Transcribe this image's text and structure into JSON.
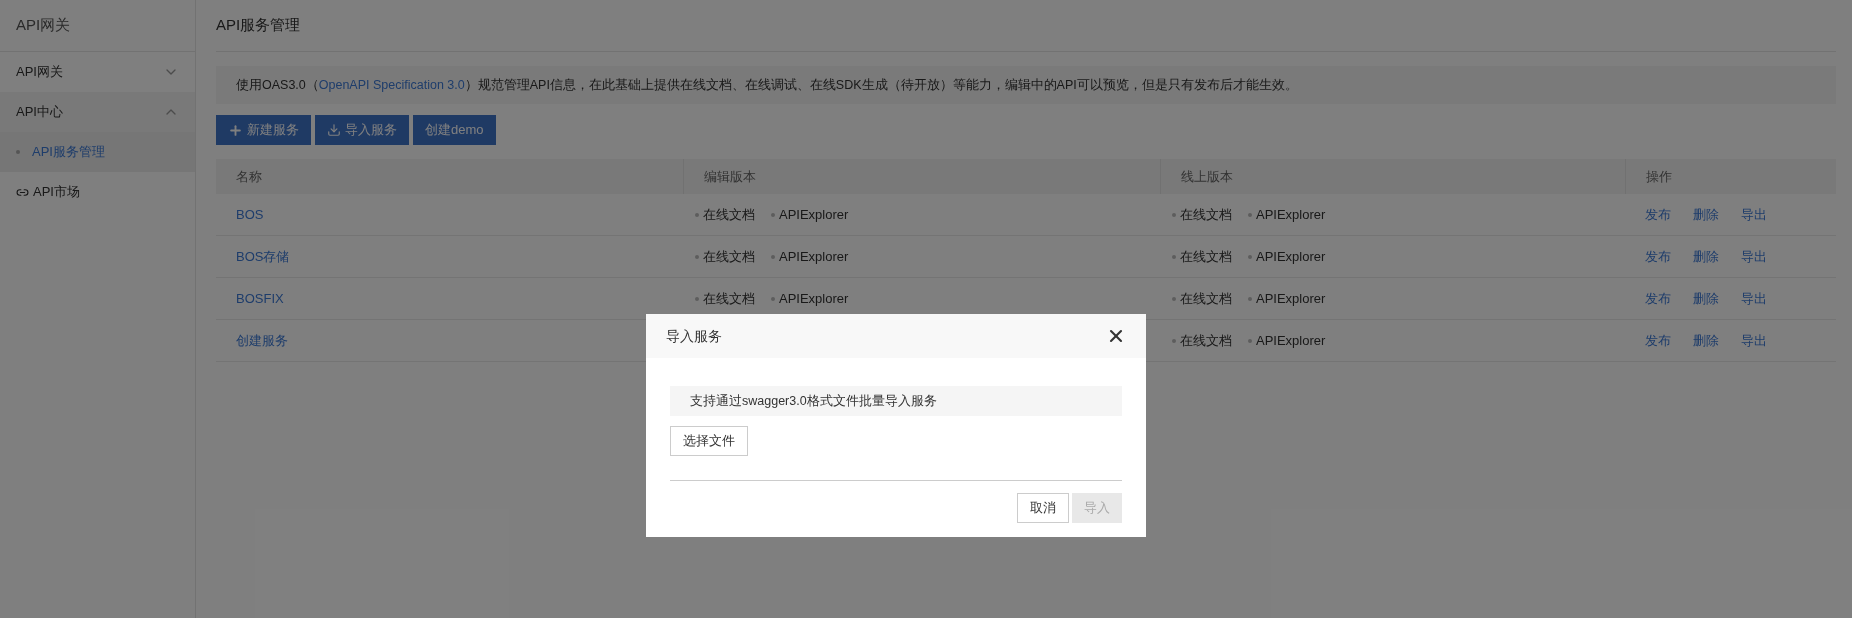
{
  "sidebar": {
    "title": "API网关",
    "items": [
      {
        "label": "API网关",
        "kind": "group",
        "expanded": false
      },
      {
        "label": "API中心",
        "kind": "group",
        "expanded": true,
        "children": [
          {
            "label": "API服务管理",
            "selected": true
          }
        ]
      },
      {
        "label": "API市场",
        "kind": "link"
      }
    ]
  },
  "page": {
    "title": "API服务管理",
    "notice": {
      "before": "使用OAS3.0（",
      "link": "OpenAPI Specification 3.0",
      "after": "）规范管理API信息，在此基础上提供在线文档、在线调试、在线SDK生成（待开放）等能力，编辑中的API可以预览，但是只有发布后才能生效。"
    },
    "toolbar": [
      {
        "label": "新建服务",
        "kind": "create"
      },
      {
        "label": "导入服务",
        "kind": "import"
      },
      {
        "label": "创建demo",
        "kind": "plain"
      }
    ],
    "table": {
      "columns": [
        "名称",
        "编辑版本",
        "线上版本",
        "操作"
      ],
      "rows": [
        {
          "name": "BOS",
          "edit_version": [
            "在线文档",
            "APIExplorer"
          ],
          "online_version": [
            "在线文档",
            "APIExplorer"
          ],
          "actions": [
            "发布",
            "删除",
            "导出"
          ]
        },
        {
          "name": "BOS存储",
          "edit_version": [
            "在线文档",
            "APIExplorer"
          ],
          "online_version": [
            "在线文档",
            "APIExplorer"
          ],
          "actions": [
            "发布",
            "删除",
            "导出"
          ]
        },
        {
          "name": "BOSFIX",
          "edit_version": [
            "在线文档",
            "APIExplorer"
          ],
          "online_version": [
            "在线文档",
            "APIExplorer"
          ],
          "actions": [
            "发布",
            "删除",
            "导出"
          ]
        },
        {
          "name": "创建服务",
          "online_version": [
            "在线文档",
            "APIExplorer"
          ],
          "actions": [
            "发布",
            "删除",
            "导出"
          ]
        }
      ]
    }
  },
  "dialog": {
    "title": "导入服务",
    "hint": "支持通过swagger3.0格式文件批量导入服务",
    "file_button": "选择文件",
    "buttons": [
      {
        "label": "取消",
        "disabled": false
      },
      {
        "label": "导入",
        "disabled": true
      }
    ]
  }
}
